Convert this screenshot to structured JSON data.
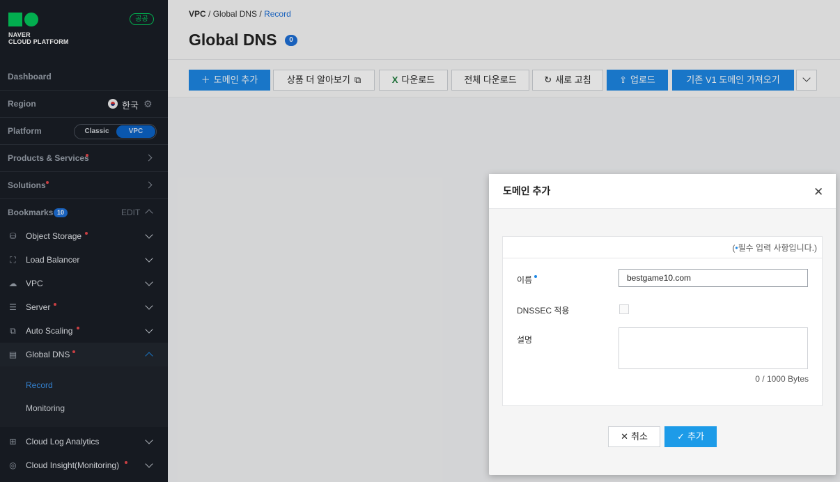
{
  "sidebar": {
    "logo_line1": "NAVER",
    "logo_line2": "CLOUD PLATFORM",
    "gov_badge": "공공",
    "dashboard": "Dashboard",
    "region_label": "Region",
    "region_value": "한국",
    "platform_label": "Platform",
    "platform_classic": "Classic",
    "platform_vpc": "VPC",
    "products": "Products & Services",
    "solutions": "Solutions",
    "bookmarks": "Bookmarks",
    "bookmarks_count": "10",
    "bookmarks_edit": "EDIT",
    "items": [
      {
        "label": "Object Storage",
        "icon": "database-icon"
      },
      {
        "label": "Load Balancer",
        "icon": "load-balancer-icon"
      },
      {
        "label": "VPC",
        "icon": "vpc-cloud-icon"
      },
      {
        "label": "Server",
        "icon": "server-icon"
      },
      {
        "label": "Auto Scaling",
        "icon": "auto-scaling-icon"
      },
      {
        "label": "Global DNS",
        "icon": "global-dns-icon"
      },
      {
        "label": "Cloud Log Analytics",
        "icon": "log-analytics-icon"
      },
      {
        "label": "Cloud Insight(Monitoring)",
        "icon": "cloud-insight-icon"
      }
    ],
    "sub_items": [
      "Record",
      "Monitoring"
    ]
  },
  "breadcrumb": [
    "VPC",
    "Global DNS",
    "Record"
  ],
  "page": {
    "title": "Global DNS",
    "count": "0"
  },
  "toolbar": {
    "add_domain": "도메인 추가",
    "learn_more": "상품 더 알아보기",
    "download": "다운로드",
    "download_all": "전체 다운로드",
    "refresh": "새로 고침",
    "upload": "업로드",
    "import_v1": "기존 V1 도메인 가져오기"
  },
  "modal": {
    "title": "도메인 추가",
    "required_note": "필수 입력 사항입니다.",
    "name_label": "이름",
    "name_value": "bestgame10.com",
    "dnssec_label": "DNSSEC 적용",
    "desc_label": "설명",
    "bytes": "0 / 1000 Bytes",
    "cancel": "취소",
    "add": "추가"
  },
  "colors": {
    "sidebar_bg": "#1a1e26",
    "primary": "#1d87e4",
    "brand_green": "#03c75a",
    "required_dot": "#e5484d"
  }
}
